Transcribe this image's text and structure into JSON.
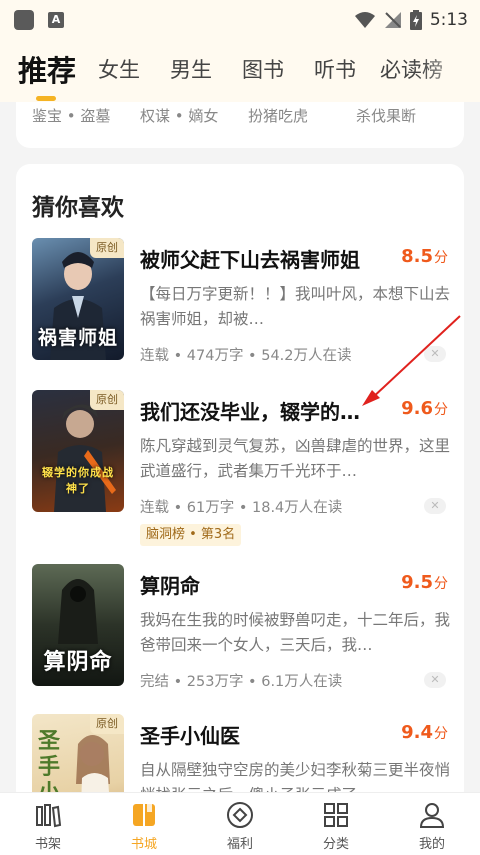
{
  "status_bar": {
    "time": "5:13",
    "app_badge": "A"
  },
  "tabs": [
    {
      "label": "推荐",
      "active": true
    },
    {
      "label": "女生"
    },
    {
      "label": "男生"
    },
    {
      "label": "图书"
    },
    {
      "label": "听书"
    },
    {
      "label": "必读榜"
    }
  ],
  "category_tags": [
    "鉴宝 • 盗墓",
    "权谋 • 嫡女",
    "扮猪吃虎",
    "杀伐果断"
  ],
  "section": {
    "title": "猜你喜欢"
  },
  "books": [
    {
      "title": "被师父赶下山去祸害师姐",
      "score": "8.5",
      "score_unit": "分",
      "badge": "原创",
      "cover_text": "祸害师姐",
      "desc": "【每日万字更新！！】我叫叶风，本想下山去祸害师姐，却被…",
      "meta": "连载 • 474万字 • 54.2万人在读",
      "close": "✕"
    },
    {
      "title": "我们还没毕业，辍学的…",
      "score": "9.6",
      "score_unit": "分",
      "badge": "原创",
      "cover_text": "辍学的你成战神了",
      "desc": "陈凡穿越到灵气复苏，凶兽肆虐的世界，这里武道盛行，武者集万千光环于…",
      "meta": "连载 • 61万字 • 18.4万人在读",
      "rank": "脑洞榜 • 第3名",
      "close": "✕"
    },
    {
      "title": "算阴命",
      "score": "9.5",
      "score_unit": "分",
      "cover_text": "算阴命",
      "desc": "我妈在生我的时候被野兽叼走，十二年后，我爸带回来一个女人，三天后，我…",
      "meta": "完结 • 253万字 • 6.1万人在读",
      "close": "✕"
    },
    {
      "title": "圣手小仙医",
      "score": "9.4",
      "score_unit": "分",
      "badge": "原创",
      "cover_text": "圣手小仙",
      "desc": "自从隔壁独守空房的美少妇李秋菊三更半夜悄悄找张元之后，傻小子张元成了…",
      "meta": "",
      "close": "✕"
    }
  ],
  "bottom_nav": [
    {
      "label": "书架",
      "icon": "bookshelf-icon"
    },
    {
      "label": "书城",
      "icon": "bookstore-icon",
      "active": true
    },
    {
      "label": "福利",
      "icon": "gift-diamond-icon"
    },
    {
      "label": "分类",
      "icon": "grid-icon"
    },
    {
      "label": "我的",
      "icon": "user-icon"
    }
  ],
  "colors": {
    "accent": "#f5b323",
    "score": "#ef5a1c",
    "active_nav": "#f5a623"
  }
}
